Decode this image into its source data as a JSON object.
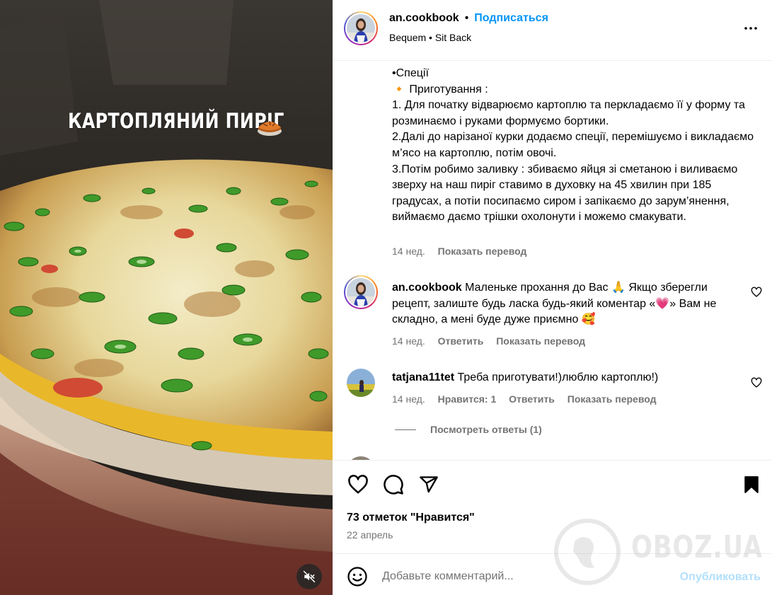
{
  "media": {
    "overlay_title": "КАРТОПЛЯНИЙ ПИРІГ",
    "overlay_emoji": "pie-emoji",
    "mute_icon": "speaker-muted-icon"
  },
  "header": {
    "username": "an.cookbook",
    "separator": "•",
    "follow_label": "Подписаться",
    "audio_line": "Bequem • Sit Back",
    "more_icon": "more-horizontal-icon"
  },
  "caption": {
    "text": "•Спеції\n🔸 Приготування :\n1. Для початку відварюємо картоплю та перкладаємо її у форму та розминаємо і руками формуємо бортики.\n2.Далі до нарізаної курки додаємо спеції, перемішуємо і викладаємо м’ясо на картоплю, потім овочі.\n3.Потім робимо заливку : збиваємо яйця зі сметаною і виливаємо зверху на наш пиріг ставимо в духовку на 45 хвилин при 185 градусах, а потіи посипаємо сиром і запікаємо до зарум’янення, виймаємо даємо трішки охолонути і можемо смакувати.",
    "time": "14 нед.",
    "translate": "Показать перевод"
  },
  "comments": [
    {
      "username": "an.cookbook",
      "text": "Маленьке прохання до Вас 🙏 Якщо зберегли рецепт, залиште будь ласка будь-який коментар «💗» Вам не складно, а мені буде дуже приємно 🥰",
      "time": "14 нед.",
      "reply": "Ответить",
      "translate": "Показать перевод"
    },
    {
      "username": "tatjana11tet",
      "text": "Треба приготувати!)люблю картоплю!)",
      "time": "14 нед.",
      "likes": "Нравится: 1",
      "reply": "Ответить",
      "translate": "Показать перевод",
      "view_replies": "Посмотреть ответы (1)"
    }
  ],
  "actions": {
    "like_icon": "heart-icon",
    "comment_icon": "comment-icon",
    "share_icon": "share-icon",
    "save_icon": "bookmark-filled-icon",
    "likes_text": "73 отметок \"Нравится\"",
    "date": "22 апрель"
  },
  "comment_box": {
    "emoji_icon": "smiley-icon",
    "placeholder": "Добавьте комментарий...",
    "publish_label": "Опубликовать"
  },
  "watermark": {
    "text": "OBOZ.UA"
  }
}
